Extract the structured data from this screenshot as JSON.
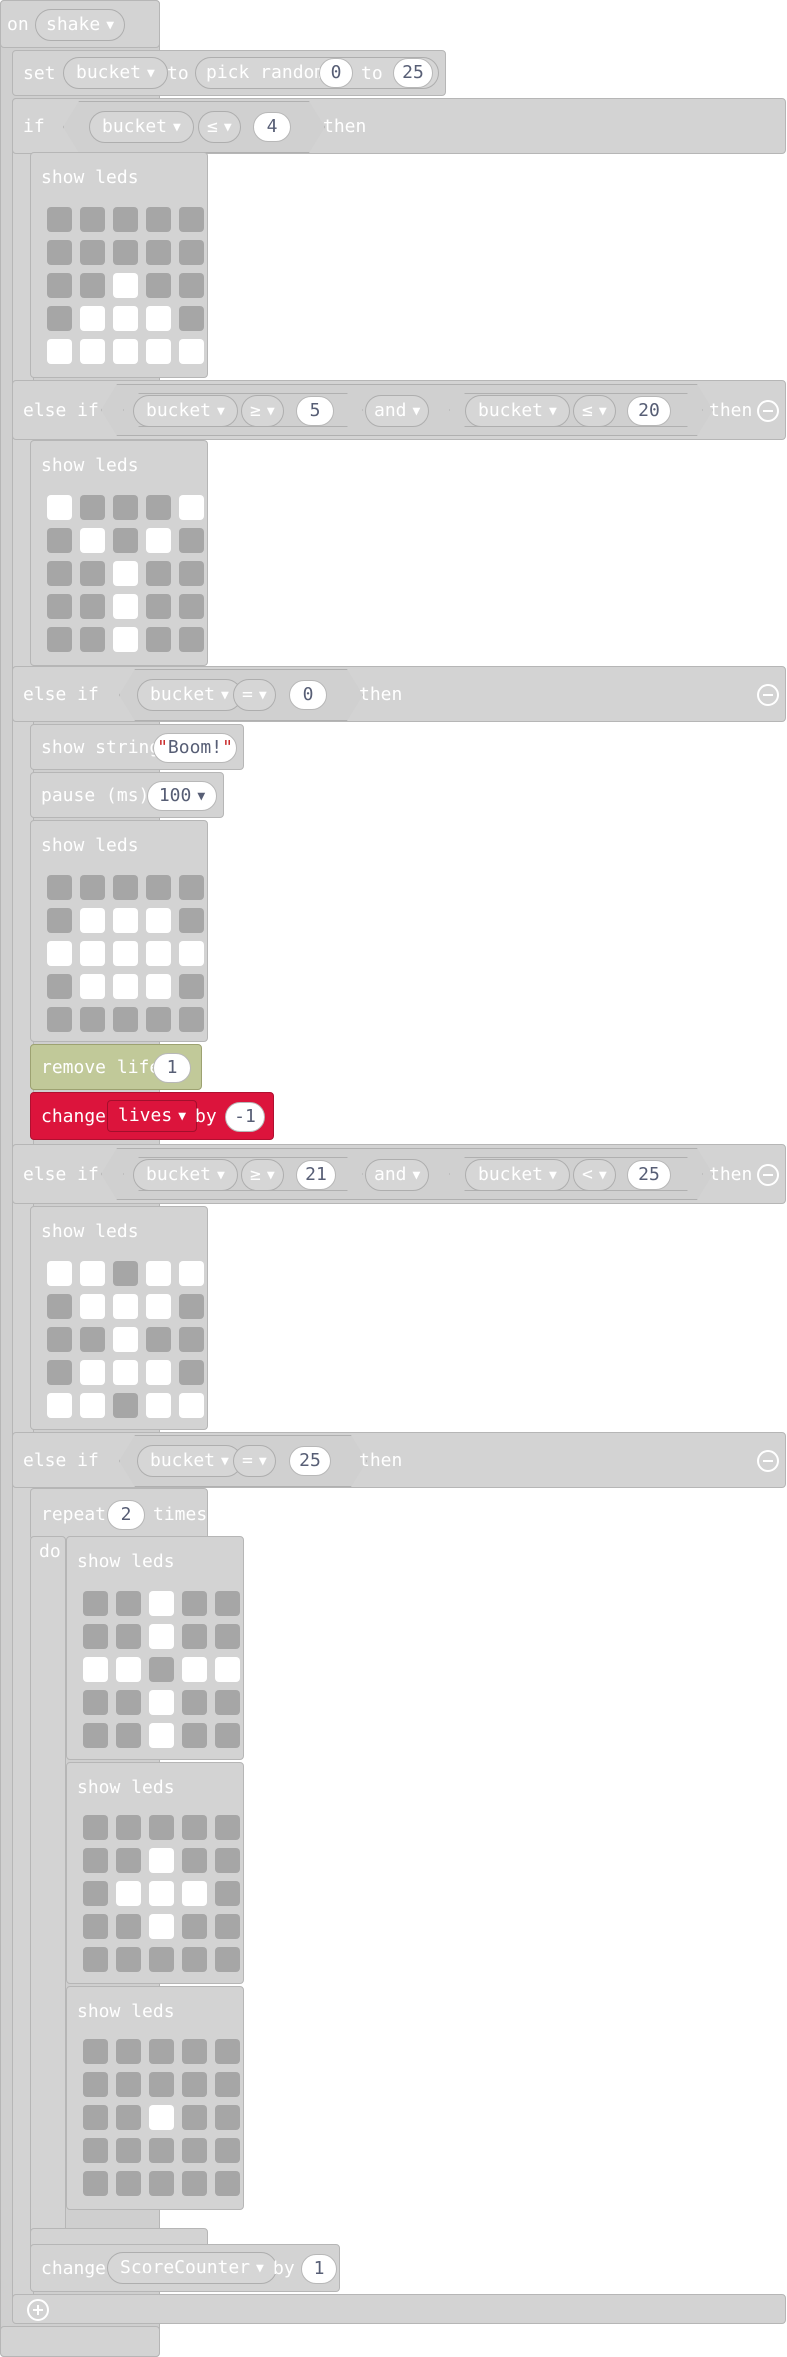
{
  "event": {
    "on": "on",
    "trigger": "shake"
  },
  "set_block": {
    "set": "set",
    "variable": "bucket",
    "to": "to",
    "pick_random": "pick random",
    "min": "0",
    "to2": "to",
    "max": "25"
  },
  "if_block": {
    "if_label": "if",
    "then_label": "then",
    "else_if_label": "else if",
    "cond1": {
      "var": "bucket",
      "op": "≤",
      "value": "4"
    },
    "cond2": {
      "var1": "bucket",
      "op1": "≥",
      "val1": "5",
      "and": "and",
      "var2": "bucket",
      "op2": "≤",
      "val2": "20"
    },
    "cond3": {
      "var": "bucket",
      "op": "=",
      "value": "0"
    },
    "cond4": {
      "var1": "bucket",
      "op1": "≥",
      "val1": "21",
      "and": "and",
      "var2": "bucket",
      "op2": "<",
      "val2": "25"
    },
    "cond5": {
      "var": "bucket",
      "op": "=",
      "value": "25"
    }
  },
  "show_leds_label": "show leds",
  "show_string": {
    "label": "show string",
    "value": "Boom!"
  },
  "pause": {
    "label": "pause (ms)",
    "value": "100"
  },
  "remove_life": {
    "label": "remove life",
    "value": "1"
  },
  "change_lives": {
    "change": "change",
    "variable": "lives",
    "by": "by",
    "value": "-1"
  },
  "repeat": {
    "label": "repeat",
    "count": "2",
    "times": "times",
    "do": "do"
  },
  "change_score": {
    "change": "change",
    "variable": "ScoreCounter",
    "by": "by",
    "value": "1"
  },
  "led_patterns": {
    "p1": [
      [
        0,
        0,
        0,
        0,
        0
      ],
      [
        0,
        0,
        0,
        0,
        0
      ],
      [
        0,
        0,
        1,
        0,
        0
      ],
      [
        0,
        1,
        1,
        1,
        0
      ],
      [
        1,
        1,
        1,
        1,
        1
      ]
    ],
    "p2": [
      [
        1,
        0,
        0,
        0,
        1
      ],
      [
        0,
        1,
        0,
        1,
        0
      ],
      [
        0,
        0,
        1,
        0,
        0
      ],
      [
        0,
        0,
        1,
        0,
        0
      ],
      [
        0,
        0,
        1,
        0,
        0
      ]
    ],
    "p3": [
      [
        0,
        0,
        0,
        0,
        0
      ],
      [
        0,
        1,
        1,
        1,
        0
      ],
      [
        1,
        1,
        1,
        1,
        1
      ],
      [
        0,
        1,
        1,
        1,
        0
      ],
      [
        0,
        0,
        0,
        0,
        0
      ]
    ],
    "p4": [
      [
        1,
        1,
        0,
        1,
        1
      ],
      [
        0,
        1,
        1,
        1,
        0
      ],
      [
        0,
        0,
        1,
        0,
        0
      ],
      [
        0,
        1,
        1,
        1,
        0
      ],
      [
        1,
        1,
        0,
        1,
        1
      ]
    ],
    "p5": [
      [
        0,
        0,
        1,
        0,
        0
      ],
      [
        0,
        0,
        1,
        0,
        0
      ],
      [
        1,
        1,
        0,
        1,
        1
      ],
      [
        0,
        0,
        1,
        0,
        0
      ],
      [
        0,
        0,
        1,
        0,
        0
      ]
    ],
    "p6": [
      [
        0,
        0,
        0,
        0,
        0
      ],
      [
        0,
        0,
        1,
        0,
        0
      ],
      [
        0,
        1,
        1,
        1,
        0
      ],
      [
        0,
        0,
        1,
        0,
        0
      ],
      [
        0,
        0,
        0,
        0,
        0
      ]
    ],
    "p7": [
      [
        0,
        0,
        0,
        0,
        0
      ],
      [
        0,
        0,
        0,
        0,
        0
      ],
      [
        0,
        0,
        1,
        0,
        0
      ],
      [
        0,
        0,
        0,
        0,
        0
      ],
      [
        0,
        0,
        0,
        0,
        0
      ]
    ]
  },
  "colors": {
    "block_gray": "#d3d3d3",
    "led_off": "#a6a6a6",
    "led_on": "#ffffff",
    "remove_life": "#c1c999",
    "change_lives": "#dc143c"
  }
}
